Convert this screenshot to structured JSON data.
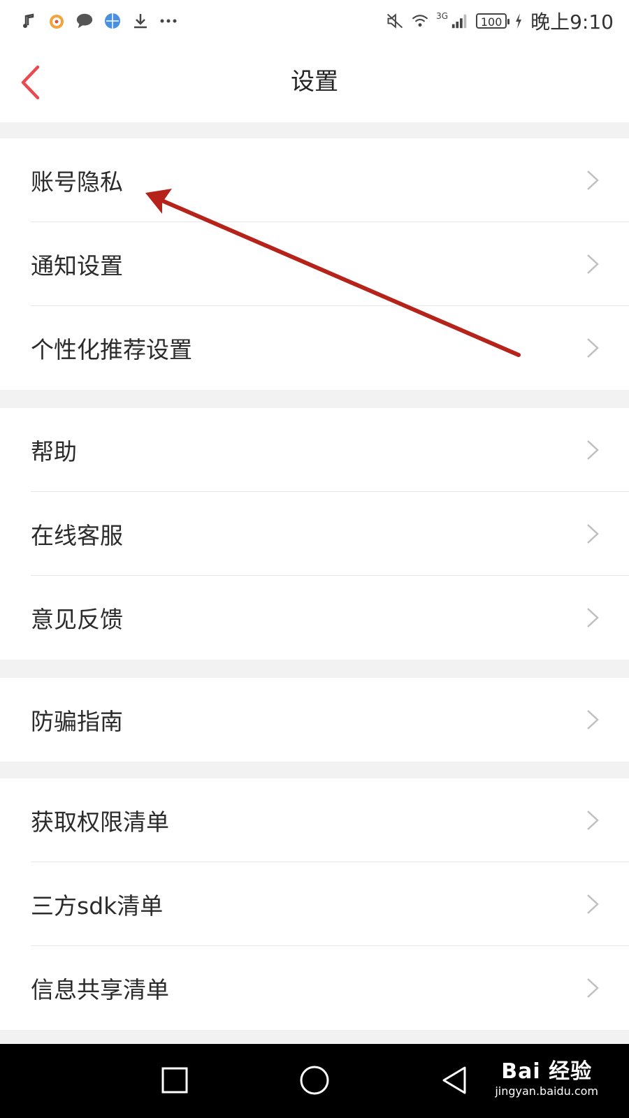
{
  "status_bar": {
    "left_icons": [
      "music-icon",
      "weibo-icon",
      "chat-icon",
      "browser-icon",
      "download-icon",
      "more-dots-icon"
    ],
    "network": "3G",
    "battery": "100",
    "time": "晚上9:10"
  },
  "header": {
    "title": "设置",
    "back_icon": "chevron-left-icon",
    "accent_color": "#ea4a4f"
  },
  "groups": [
    {
      "items": [
        {
          "label": "账号隐私"
        },
        {
          "label": "通知设置"
        },
        {
          "label": "个性化推荐设置"
        }
      ]
    },
    {
      "items": [
        {
          "label": "帮助"
        },
        {
          "label": "在线客服"
        },
        {
          "label": "意见反馈"
        }
      ]
    },
    {
      "items": [
        {
          "label": "防骗指南"
        }
      ]
    },
    {
      "items": [
        {
          "label": "获取权限清单"
        },
        {
          "label": "三方sdk清单"
        },
        {
          "label": "信息共享清单"
        }
      ]
    }
  ],
  "annotation": {
    "color": "#b5231b"
  },
  "watermark": {
    "brand": "Bai  经验",
    "url": "jingyan.baidu.com"
  }
}
